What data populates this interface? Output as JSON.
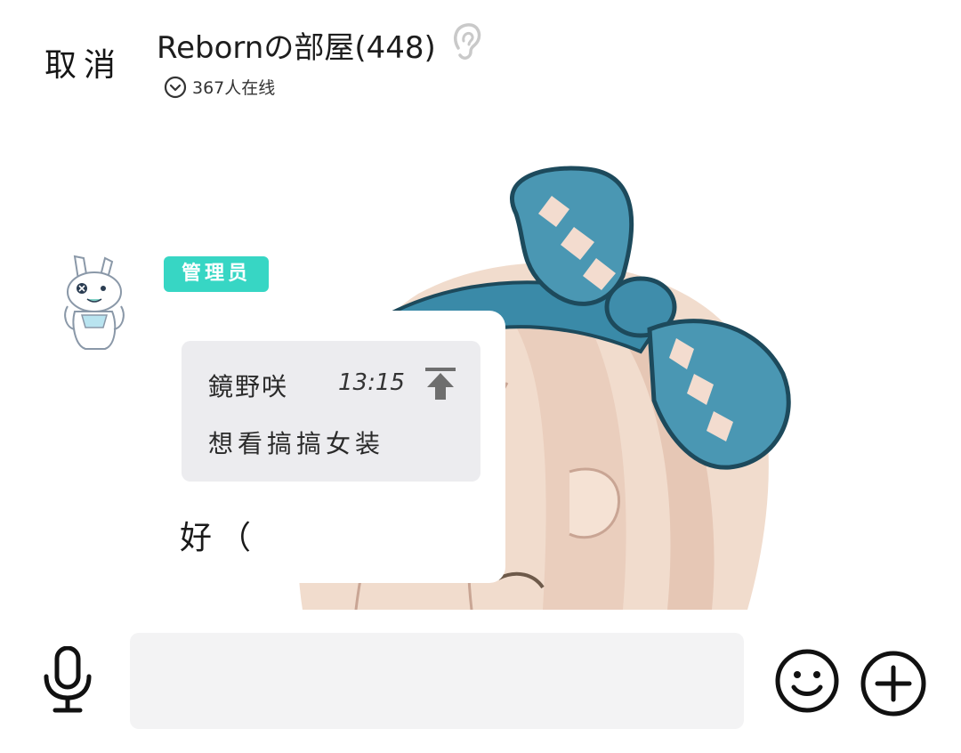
{
  "header": {
    "cancel_label": "取消",
    "room_title": "Rebornの部屋(448)",
    "online_count": "367人在线",
    "icons": {
      "audio": "ear-icon",
      "expand": "chevron-down-circle-icon"
    }
  },
  "message": {
    "role_badge": "管理员",
    "badge_color": "#37d6c4",
    "quote": {
      "author": "鏡野咲",
      "time": "13:15",
      "text": "想看搞搞女装",
      "icon": "pin-to-top-icon"
    },
    "reply_text": "好（"
  },
  "composer": {
    "input_value": "",
    "icons": {
      "voice": "microphone-icon",
      "emoji": "emoji-icon",
      "more": "plus-icon"
    }
  }
}
